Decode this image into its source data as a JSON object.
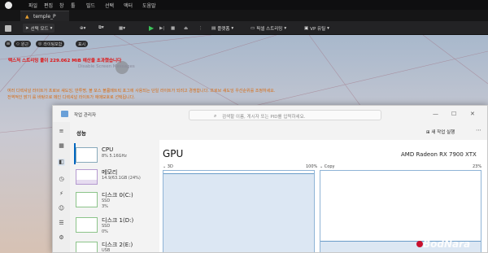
{
  "menubar": {
    "items": [
      "파일",
      "편집",
      "창",
      "툴",
      "빌드",
      "선택",
      "액터",
      "도움말"
    ]
  },
  "tab": {
    "label": "temple_P"
  },
  "toolbar": {
    "mode_label": "선택 모드",
    "platforms_label": "플랫폼",
    "pixel_streaming_label": "픽셀 스트리밍",
    "vp_label": "VP 유틸"
  },
  "viewport": {
    "view_btn": "원근",
    "lit_btn": "라이팅포함",
    "show_btn": "표시",
    "warning_red": "텍스처 스트리밍 풀이 229.062 MiB 예산을 초과했습니다",
    "warning_gray": "Disable Screen Messages",
    "warning_orange_1": "여러 디렉셔널 라이트가 프로브 섀도잉, 반투명, 볼 포스 볼륨메트릭 포그에 사용되는 단일 라이트가 되려고 경쟁합니다. 프로브 섀도잉 우선순위를 조정하세요.",
    "warning_orange_2": "전역적인 밝기 를 바탕으로 메인 디렉셔널 라이트가 애매모호로 선택됩니다."
  },
  "task_manager": {
    "title": "작업 관리자",
    "search_placeholder": "검색할 이름, 게시자 또는 PID를 입력하세요.",
    "section_title": "성능",
    "new_task": "새 작업 실행",
    "resources": [
      {
        "name": "CPU",
        "sub1": "8% 5.16GHz",
        "sub2": ""
      },
      {
        "name": "메모리",
        "sub1": "14.9/63.1GB (24%)",
        "sub2": ""
      },
      {
        "name": "디스크 0(C:)",
        "sub1": "SSD",
        "sub2": "3%"
      },
      {
        "name": "디스크 1(D:)",
        "sub1": "SSD",
        "sub2": "0%"
      },
      {
        "name": "디스크 2(E:)",
        "sub1": "USB",
        "sub2": ""
      }
    ],
    "gpu": {
      "title": "GPU",
      "model": "AMD Radeon RX 7900 XTX",
      "graph1_label": "3D",
      "graph1_max": "100%",
      "graph2_label": "Copy",
      "graph2_max": "23%",
      "graph1_level": 0.97,
      "graph2_level": 0.15
    }
  },
  "watermark": "BodNara",
  "colors": {
    "accent": "#0067c0",
    "warning_red": "#e01010",
    "warning_orange": "#d86a10"
  }
}
